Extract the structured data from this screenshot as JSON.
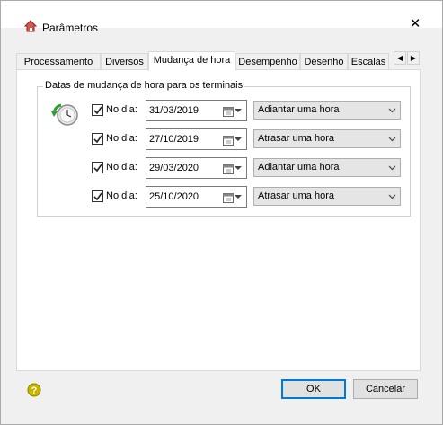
{
  "window": {
    "title": "Parâmetros"
  },
  "tabs": [
    {
      "label": "Processamento"
    },
    {
      "label": "Diversos"
    },
    {
      "label": "Mudança de hora",
      "active": true
    },
    {
      "label": "Desempenho"
    },
    {
      "label": "Desenho"
    },
    {
      "label": "Escalas"
    }
  ],
  "group": {
    "title": "Datas de mudança de hora para os terminais"
  },
  "rows": [
    {
      "checked": true,
      "label": "No dia:",
      "date": "31/03/2019",
      "action": "Adiantar uma hora"
    },
    {
      "checked": true,
      "label": "No dia:",
      "date": "27/10/2019",
      "action": "Atrasar uma hora"
    },
    {
      "checked": true,
      "label": "No dia:",
      "date": "29/03/2020",
      "action": "Adiantar uma hora"
    },
    {
      "checked": true,
      "label": "No dia:",
      "date": "25/10/2020",
      "action": "Atrasar uma hora"
    }
  ],
  "buttons": {
    "ok": "OK",
    "cancel": "Cancelar"
  },
  "icons": {
    "app": "house-icon",
    "help": "help-icon",
    "clock": "clock-refresh-icon"
  },
  "colors": {
    "accent": "#0078d7",
    "help": "#c8b400"
  }
}
